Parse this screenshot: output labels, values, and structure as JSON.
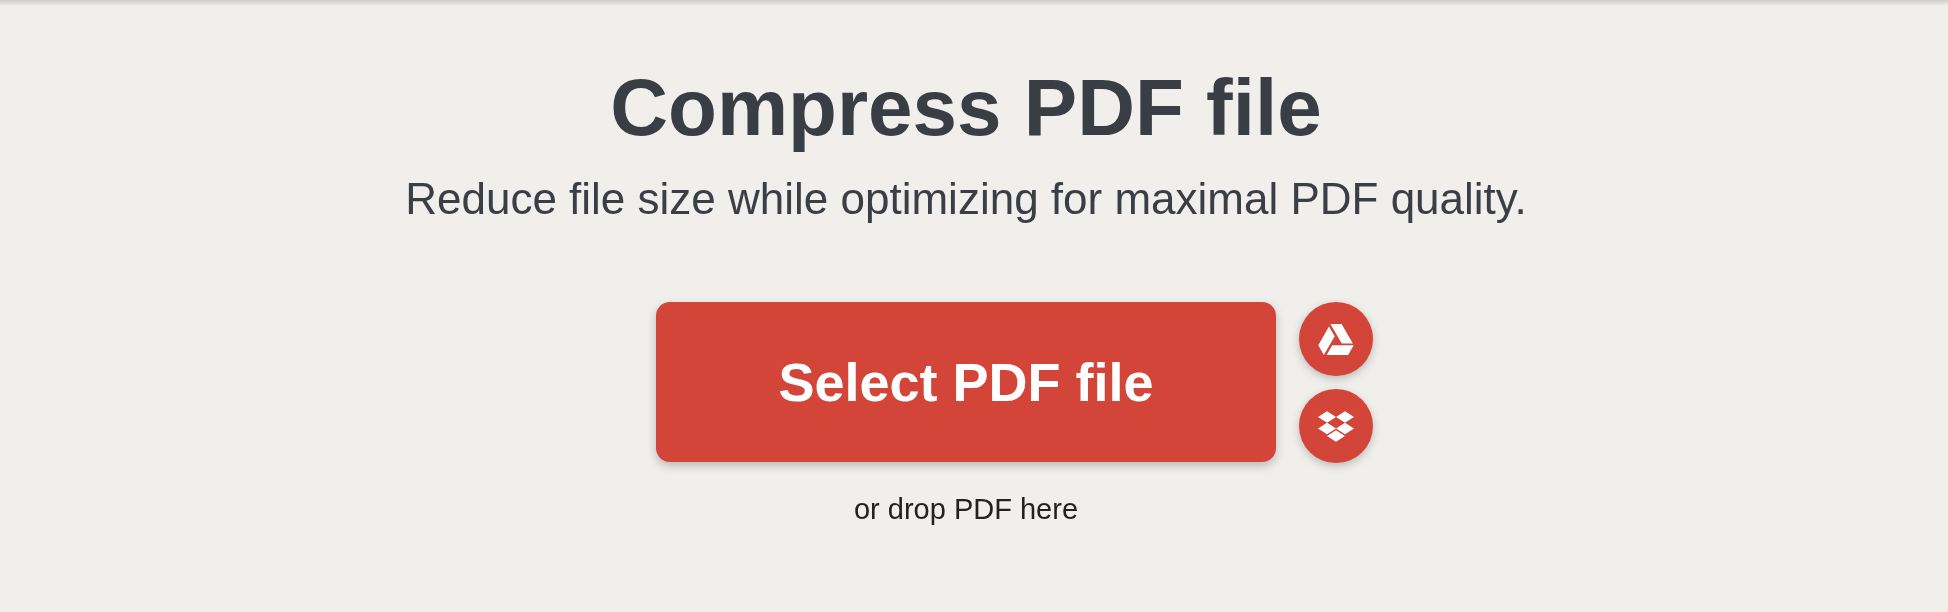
{
  "title": "Compress PDF file",
  "subtitle": "Reduce file size while optimizing for maximal PDF quality.",
  "upload": {
    "button": "Select PDF file",
    "sources": [
      {
        "kind": "drive"
      },
      {
        "kind": "dropbox"
      }
    ],
    "drop_hint": "or drop PDF here"
  }
}
